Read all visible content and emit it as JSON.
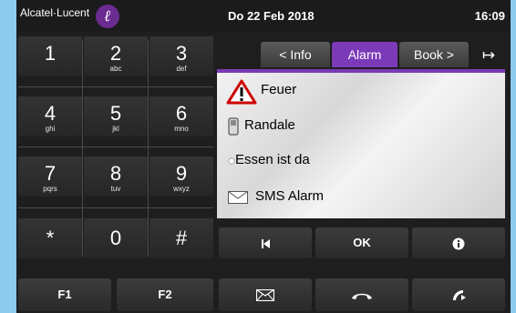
{
  "header": {
    "brand": "Alcatel·Lucent",
    "date": "Do 22 Feb 2018",
    "time": "16:09"
  },
  "keypad": {
    "keys": [
      {
        "main": "1",
        "sub": ""
      },
      {
        "main": "2",
        "sub": "abc"
      },
      {
        "main": "3",
        "sub": "def"
      },
      {
        "main": "4",
        "sub": "ghi"
      },
      {
        "main": "5",
        "sub": "jkl"
      },
      {
        "main": "6",
        "sub": "mno"
      },
      {
        "main": "7",
        "sub": "pqrs"
      },
      {
        "main": "8",
        "sub": "tuv"
      },
      {
        "main": "9",
        "sub": "wxyz"
      },
      {
        "main": "*",
        "sub": ""
      },
      {
        "main": "0",
        "sub": ""
      },
      {
        "main": "#",
        "sub": ""
      }
    ],
    "f1": "F1",
    "f2": "F2"
  },
  "tabs": {
    "info": "< Info",
    "alarm": "Alarm",
    "book": "Book >"
  },
  "list": {
    "items": [
      {
        "label": "Feuer",
        "icon": "warning-triangle-icon"
      },
      {
        "label": "Randale",
        "icon": "phone-handset-icon"
      },
      {
        "label": "Essen ist da",
        "icon": "bullet-dot-icon"
      },
      {
        "label": "SMS Alarm",
        "icon": "envelope-icon"
      }
    ]
  },
  "actions": {
    "ok": "OK"
  },
  "colors": {
    "accent": "#7b3ab8",
    "background": "#1e1e1e",
    "frame": "#8ec9ee"
  }
}
